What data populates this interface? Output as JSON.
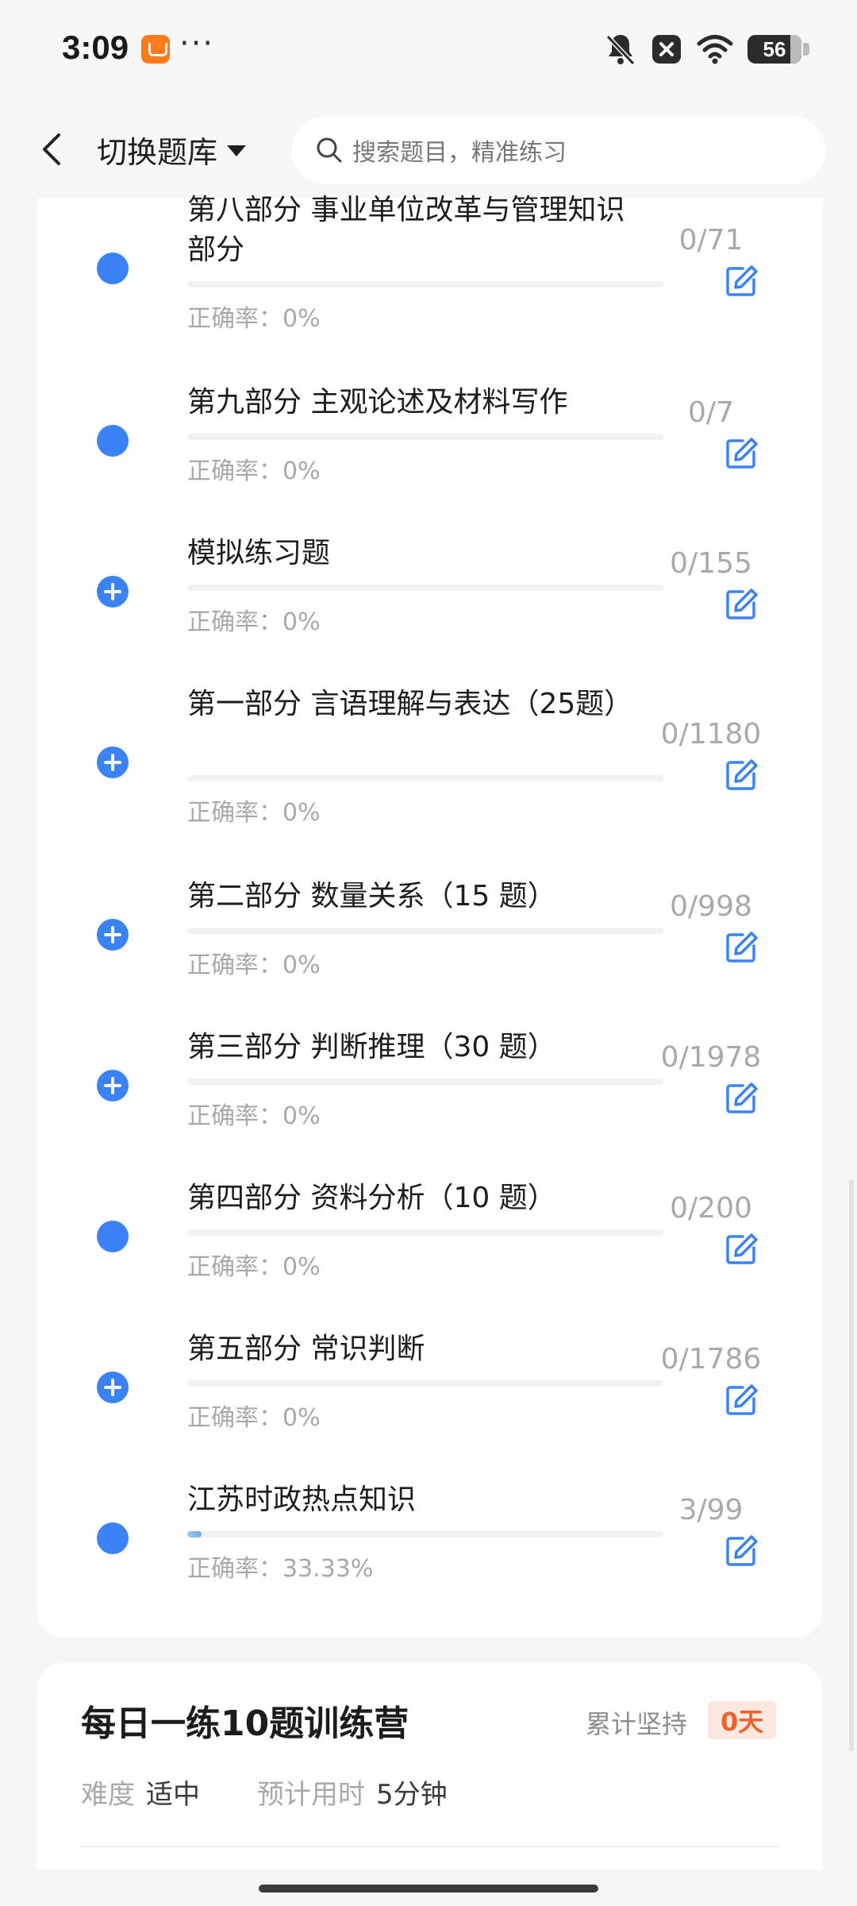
{
  "status_bar": {
    "time": "3:09",
    "more": "···",
    "battery": "56"
  },
  "header": {
    "title": "切换题库",
    "search_placeholder": "搜索题目，精准练习"
  },
  "items": [
    {
      "title": "第八部分 事业单位改革与管理知识部分",
      "count": "0/71",
      "accuracy": "正确率：0%",
      "icon": "solid-dot",
      "progress": 0
    },
    {
      "title": "第九部分 主观论述及材料写作",
      "count": "0/7",
      "accuracy": "正确率：0%",
      "icon": "solid-dot",
      "progress": 0
    },
    {
      "title": "模拟练习题",
      "count": "0/155",
      "accuracy": "正确率：0%",
      "icon": "plus-circle",
      "progress": 0
    },
    {
      "title": "第一部分 言语理解与表达（25题）",
      "count": "0/1180",
      "accuracy": "正确率：0%",
      "icon": "plus-circle",
      "progress": 0
    },
    {
      "title": "第二部分 数量关系（15 题）",
      "count": "0/998",
      "accuracy": "正确率：0%",
      "icon": "plus-circle",
      "progress": 0
    },
    {
      "title": "第三部分 判断推理（30 题）",
      "count": "0/1978",
      "accuracy": "正确率：0%",
      "icon": "plus-circle",
      "progress": 0
    },
    {
      "title": "第四部分 资料分析（10 题）",
      "count": "0/200",
      "accuracy": "正确率：0%",
      "icon": "solid-dot",
      "progress": 0
    },
    {
      "title": "第五部分 常识判断",
      "count": "0/1786",
      "accuracy": "正确率：0%",
      "icon": "plus-circle",
      "progress": 0
    },
    {
      "title": "江苏时政热点知识",
      "count": "3/99",
      "accuracy": "正确率：33.33%",
      "icon": "solid-dot",
      "progress": 0.0303
    }
  ],
  "daily": {
    "title": "每日一练10题训练营",
    "streak_label": "累计坚持",
    "streak_value": "0天",
    "difficulty_label": "难度",
    "difficulty_value": "适中",
    "time_label": "预计用时",
    "time_value": "5分钟"
  },
  "colors": {
    "accent": "#3b82f6",
    "streak": "#f0602a"
  }
}
